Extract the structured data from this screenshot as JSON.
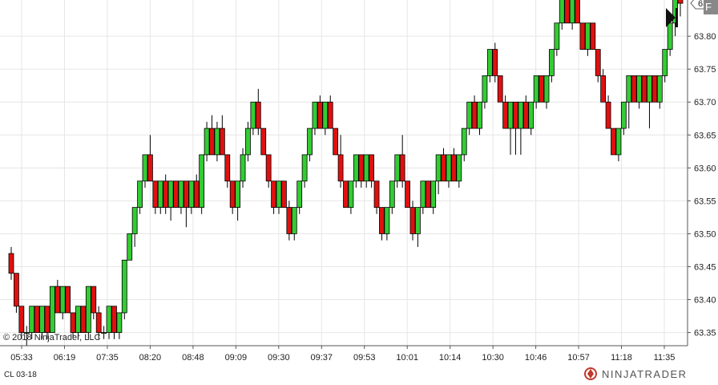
{
  "chart_data": {
    "type": "candlestick",
    "instrument": "CL 03-18",
    "copyright": "© 2018 NinjaTrader, LLC",
    "brand": "NINJATRADER",
    "current_price_label": "63.85",
    "y_ticks": [
      "63.35",
      "63.40",
      "63.45",
      "63.50",
      "63.55",
      "63.60",
      "63.65",
      "63.70",
      "63.75",
      "63.80"
    ],
    "x_ticks": [
      "05:33",
      "06:19",
      "07:35",
      "08:20",
      "08:48",
      "09:09",
      "09:30",
      "09:37",
      "09:53",
      "10:01",
      "10:14",
      "10:30",
      "10:46",
      "10:57",
      "11:18",
      "11:35"
    ],
    "ylim": [
      63.33,
      63.855
    ],
    "grid": true,
    "colors": {
      "up": "#33cc33",
      "down": "#e01010",
      "wick": "#000000",
      "grid": "#e6e6e6"
    },
    "candles": [
      [
        63.47,
        63.48,
        63.43,
        63.44
      ],
      [
        63.44,
        63.44,
        63.38,
        63.39
      ],
      [
        63.39,
        63.39,
        63.34,
        63.35
      ],
      [
        63.35,
        63.36,
        63.33,
        63.35
      ],
      [
        63.35,
        63.39,
        63.34,
        63.39
      ],
      [
        63.39,
        63.39,
        63.35,
        63.35
      ],
      [
        63.35,
        63.39,
        63.34,
        63.39
      ],
      [
        63.39,
        63.39,
        63.34,
        63.35
      ],
      [
        63.35,
        63.42,
        63.35,
        63.42
      ],
      [
        63.42,
        63.43,
        63.38,
        63.38
      ],
      [
        63.38,
        63.42,
        63.37,
        63.42
      ],
      [
        63.42,
        63.42,
        63.38,
        63.38
      ],
      [
        63.38,
        63.38,
        63.34,
        63.35
      ],
      [
        63.35,
        63.39,
        63.34,
        63.39
      ],
      [
        63.39,
        63.39,
        63.35,
        63.35
      ],
      [
        63.35,
        63.42,
        63.34,
        63.42
      ],
      [
        63.42,
        63.42,
        63.37,
        63.38
      ],
      [
        63.38,
        63.39,
        63.34,
        63.35
      ],
      [
        63.35,
        63.36,
        63.34,
        63.35
      ],
      [
        63.35,
        63.39,
        63.34,
        63.39
      ],
      [
        63.39,
        63.39,
        63.34,
        63.35
      ],
      [
        63.35,
        63.38,
        63.34,
        63.38
      ],
      [
        63.38,
        63.46,
        63.37,
        63.46
      ],
      [
        63.46,
        63.5,
        63.46,
        63.5
      ],
      [
        63.5,
        63.54,
        63.48,
        63.54
      ],
      [
        63.54,
        63.58,
        63.53,
        63.58
      ],
      [
        63.58,
        63.62,
        63.57,
        63.62
      ],
      [
        63.62,
        63.65,
        63.58,
        63.58
      ],
      [
        63.58,
        63.58,
        63.53,
        63.54
      ],
      [
        63.54,
        63.58,
        63.53,
        63.58
      ],
      [
        63.58,
        63.59,
        63.53,
        63.54
      ],
      [
        63.54,
        63.58,
        63.52,
        63.58
      ],
      [
        63.58,
        63.58,
        63.54,
        63.54
      ],
      [
        63.54,
        63.58,
        63.53,
        63.58
      ],
      [
        63.58,
        63.58,
        63.51,
        63.54
      ],
      [
        63.54,
        63.58,
        63.53,
        63.58
      ],
      [
        63.58,
        63.59,
        63.54,
        63.54
      ],
      [
        63.54,
        63.62,
        63.53,
        63.62
      ],
      [
        63.62,
        63.67,
        63.61,
        63.66
      ],
      [
        63.66,
        63.68,
        63.62,
        63.62
      ],
      [
        63.62,
        63.67,
        63.61,
        63.66
      ],
      [
        63.66,
        63.68,
        63.62,
        63.62
      ],
      [
        63.62,
        63.62,
        63.57,
        63.58
      ],
      [
        63.58,
        63.58,
        63.53,
        63.54
      ],
      [
        63.54,
        63.58,
        63.52,
        63.58
      ],
      [
        63.58,
        63.63,
        63.57,
        63.62
      ],
      [
        63.62,
        63.67,
        63.61,
        63.66
      ],
      [
        63.66,
        63.7,
        63.65,
        63.7
      ],
      [
        63.7,
        63.72,
        63.65,
        63.66
      ],
      [
        63.66,
        63.66,
        63.62,
        63.62
      ],
      [
        63.62,
        63.62,
        63.57,
        63.58
      ],
      [
        63.58,
        63.58,
        63.53,
        63.54
      ],
      [
        63.54,
        63.58,
        63.53,
        63.58
      ],
      [
        63.58,
        63.58,
        63.54,
        63.54
      ],
      [
        63.54,
        63.55,
        63.49,
        63.5
      ],
      [
        63.5,
        63.54,
        63.49,
        63.54
      ],
      [
        63.54,
        63.58,
        63.53,
        63.58
      ],
      [
        63.58,
        63.62,
        63.57,
        63.62
      ],
      [
        63.62,
        63.66,
        63.61,
        63.66
      ],
      [
        63.66,
        63.7,
        63.65,
        63.7
      ],
      [
        63.7,
        63.71,
        63.66,
        63.66
      ],
      [
        63.66,
        63.7,
        63.65,
        63.7
      ],
      [
        63.7,
        63.71,
        63.66,
        63.66
      ],
      [
        63.66,
        63.66,
        63.62,
        63.62
      ],
      [
        63.62,
        63.65,
        63.57,
        63.58
      ],
      [
        63.58,
        63.58,
        63.54,
        63.54
      ],
      [
        63.54,
        63.58,
        63.53,
        63.58
      ],
      [
        63.58,
        63.62,
        63.57,
        63.62
      ],
      [
        63.62,
        63.62,
        63.57,
        63.58
      ],
      [
        63.58,
        63.62,
        63.57,
        63.62
      ],
      [
        63.62,
        63.62,
        63.57,
        63.58
      ],
      [
        63.58,
        63.58,
        63.53,
        63.54
      ],
      [
        63.54,
        63.54,
        63.49,
        63.5
      ],
      [
        63.5,
        63.54,
        63.49,
        63.54
      ],
      [
        63.54,
        63.58,
        63.53,
        63.58
      ],
      [
        63.58,
        63.62,
        63.57,
        63.62
      ],
      [
        63.62,
        63.65,
        63.57,
        63.58
      ],
      [
        63.58,
        63.58,
        63.54,
        63.54
      ],
      [
        63.54,
        63.55,
        63.49,
        63.5
      ],
      [
        63.5,
        63.54,
        63.48,
        63.54
      ],
      [
        63.54,
        63.58,
        63.53,
        63.58
      ],
      [
        63.58,
        63.58,
        63.54,
        63.54
      ],
      [
        63.54,
        63.58,
        63.53,
        63.58
      ],
      [
        63.58,
        63.62,
        63.56,
        63.62
      ],
      [
        63.62,
        63.63,
        63.58,
        63.58
      ],
      [
        63.58,
        63.62,
        63.57,
        63.62
      ],
      [
        63.62,
        63.63,
        63.58,
        63.58
      ],
      [
        63.58,
        63.62,
        63.57,
        63.62
      ],
      [
        63.62,
        63.66,
        63.61,
        63.66
      ],
      [
        63.66,
        63.7,
        63.65,
        63.7
      ],
      [
        63.7,
        63.71,
        63.66,
        63.66
      ],
      [
        63.66,
        63.7,
        63.65,
        63.7
      ],
      [
        63.7,
        63.74,
        63.69,
        63.74
      ],
      [
        63.74,
        63.78,
        63.73,
        63.78
      ],
      [
        63.78,
        63.79,
        63.73,
        63.74
      ],
      [
        63.74,
        63.74,
        63.7,
        63.7
      ],
      [
        63.7,
        63.71,
        63.66,
        63.66
      ],
      [
        63.66,
        63.7,
        63.62,
        63.7
      ],
      [
        63.7,
        63.7,
        63.62,
        63.66
      ],
      [
        63.66,
        63.7,
        63.62,
        63.7
      ],
      [
        63.7,
        63.71,
        63.66,
        63.66
      ],
      [
        63.66,
        63.7,
        63.65,
        63.7
      ],
      [
        63.7,
        63.74,
        63.69,
        63.74
      ],
      [
        63.74,
        63.74,
        63.7,
        63.7
      ],
      [
        63.7,
        63.74,
        63.69,
        63.74
      ],
      [
        63.74,
        63.78,
        63.73,
        63.78
      ],
      [
        63.78,
        63.82,
        63.77,
        63.82
      ],
      [
        63.82,
        63.86,
        63.81,
        63.86
      ],
      [
        63.86,
        63.86,
        63.82,
        63.82
      ],
      [
        63.82,
        63.86,
        63.81,
        63.86
      ],
      [
        63.86,
        63.86,
        63.82,
        63.82
      ],
      [
        63.82,
        63.82,
        63.78,
        63.78
      ],
      [
        63.78,
        63.82,
        63.77,
        63.82
      ],
      [
        63.82,
        63.82,
        63.78,
        63.78
      ],
      [
        63.78,
        63.78,
        63.73,
        63.74
      ],
      [
        63.74,
        63.75,
        63.7,
        63.7
      ],
      [
        63.7,
        63.71,
        63.66,
        63.66
      ],
      [
        63.66,
        63.66,
        63.62,
        63.62
      ],
      [
        63.62,
        63.66,
        63.61,
        63.66
      ],
      [
        63.66,
        63.7,
        63.65,
        63.7
      ],
      [
        63.7,
        63.74,
        63.66,
        63.74
      ],
      [
        63.74,
        63.74,
        63.7,
        63.7
      ],
      [
        63.7,
        63.74,
        63.69,
        63.74
      ],
      [
        63.74,
        63.74,
        63.7,
        63.7
      ],
      [
        63.7,
        63.74,
        63.66,
        63.74
      ],
      [
        63.74,
        63.74,
        63.7,
        63.7
      ],
      [
        63.7,
        63.74,
        63.69,
        63.74
      ],
      [
        63.74,
        63.78,
        63.73,
        63.78
      ],
      [
        63.78,
        63.82,
        63.77,
        63.82
      ],
      [
        63.82,
        63.86,
        63.8,
        63.86
      ],
      [
        63.86,
        63.86,
        63.83,
        63.85
      ]
    ]
  }
}
